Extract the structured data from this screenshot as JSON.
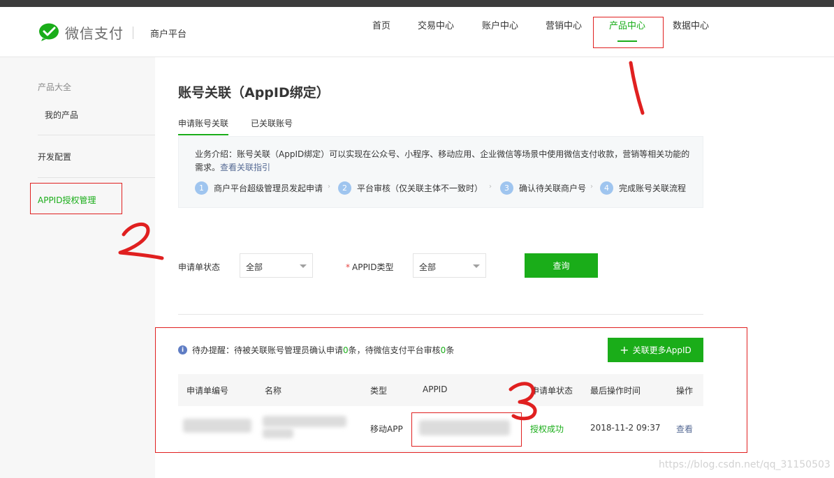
{
  "header": {
    "logo_text": "微信支付",
    "platform": "商户平台",
    "nav": [
      "首页",
      "交易中心",
      "账户中心",
      "营销中心",
      "产品中心",
      "数据中心"
    ],
    "active_nav": "产品中心"
  },
  "sidebar": {
    "group": "产品大全",
    "my_products": "我的产品",
    "dev_config": "开发配置",
    "appid_manage": "APPID授权管理"
  },
  "page": {
    "title": "账号关联（AppID绑定）",
    "tabs": [
      "申请账号关联",
      "已关联账号"
    ]
  },
  "info": {
    "intro": "业务介绍：账号关联（AppID绑定）可以实现在公众号、小程序、移动应用、企业微信等场景中使用微信支付收款，营销等相关功能的需求。",
    "link": "查看关联指引",
    "steps": [
      {
        "num": "1",
        "label": "商户平台超级管理员发起申请"
      },
      {
        "num": "2",
        "label": "平台审核（仅关联主体不一致时）"
      },
      {
        "num": "3",
        "label": "确认待关联商户号"
      },
      {
        "num": "4",
        "label": "完成账号关联流程"
      }
    ]
  },
  "filters": {
    "status_label": "申请单状态",
    "status_value": "全部",
    "type_required": "*",
    "type_label": "APPID类型",
    "type_value": "全部",
    "query_button": "查询"
  },
  "todo": {
    "icon": "i",
    "prefix": "待办提醒：待被关联账号管理员确认申请",
    "count1": "0",
    "middle": "条，待微信支付平台审核",
    "count2": "0",
    "suffix": "条",
    "more_button": "关联更多AppID"
  },
  "table": {
    "columns": [
      "申请单编号",
      "名称",
      "类型",
      "APPID",
      "申请单状态",
      "最后操作时间",
      "操作"
    ],
    "row": {
      "type": "移动APP",
      "status": "授权成功",
      "time": "2018-11-2 09:37",
      "action": "查看"
    }
  },
  "annotations": [
    "1",
    "2",
    "3"
  ],
  "watermark": "https://blog.csdn.net/qq_31150503",
  "colors": {
    "accent": "#1aad19",
    "link": "#576b95",
    "annotation": "#e02020"
  }
}
